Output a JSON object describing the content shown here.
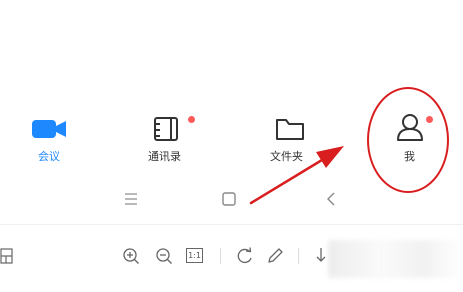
{
  "tabbar": {
    "tabs": [
      {
        "label": "会议",
        "icon": "video-camera-icon",
        "color": "#1e88ff",
        "active": true
      },
      {
        "label": "通讯录",
        "icon": "address-book-icon",
        "badge": true
      },
      {
        "label": "文件夹",
        "icon": "folder-icon"
      },
      {
        "label": "我",
        "icon": "person-icon",
        "badge": true
      }
    ]
  },
  "navbar": {
    "items": [
      "menu-icon",
      "home-square-icon",
      "back-chevron-icon"
    ]
  },
  "toolbar": {
    "page_ratio": "1:1",
    "items": [
      "layout-icon",
      "zoom-in-icon",
      "zoom-out-icon",
      "actual-size-icon",
      "rotate-icon",
      "pen-icon",
      "scroll-icon"
    ]
  },
  "colors": {
    "accent": "#1e88ff",
    "badge": "#ff5a5a",
    "annotation": "#d81e1e"
  }
}
